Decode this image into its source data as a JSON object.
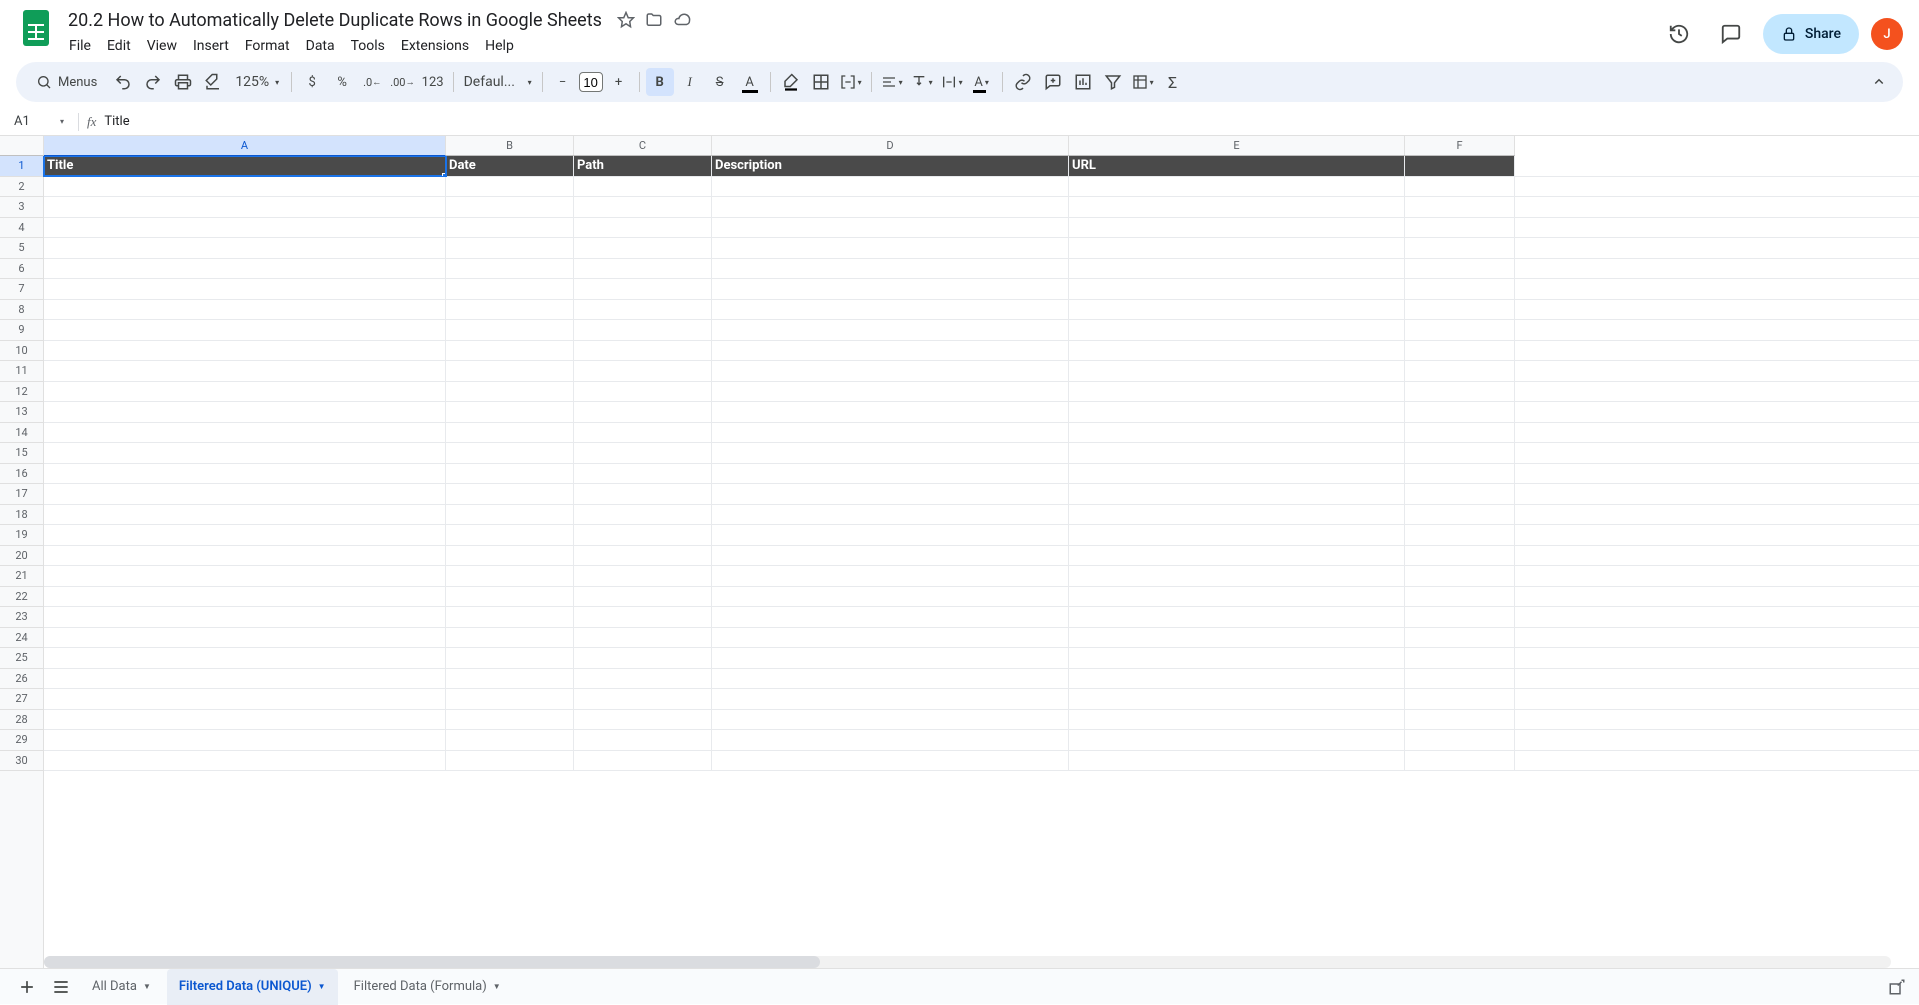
{
  "header": {
    "doc_title": "20.2 How to Automatically Delete Duplicate Rows in Google Sheets",
    "share_label": "Share",
    "avatar_initial": "J"
  },
  "menubar": [
    "File",
    "Edit",
    "View",
    "Insert",
    "Format",
    "Data",
    "Tools",
    "Extensions",
    "Help"
  ],
  "toolbar": {
    "menus_label": "Menus",
    "zoom": "125%",
    "currency": "$",
    "percent": "%",
    "dec_decrease": ".0←",
    "dec_increase": ".00→",
    "numfmt": "123",
    "font": "Defaul...",
    "font_size": "10",
    "bold": "B",
    "italic": "I",
    "strike": "S",
    "text_color": "A",
    "functions": "Σ"
  },
  "namebox": {
    "ref": "A1",
    "formula": "Title"
  },
  "columns": [
    "A",
    "B",
    "C",
    "D",
    "E",
    "F"
  ],
  "row_count": 30,
  "header_row": [
    "Title",
    "Date",
    "Path",
    "Description",
    "URL"
  ],
  "sheet_tabs": {
    "all_data": "All Data",
    "filtered_unique": "Filtered Data (UNIQUE)",
    "filtered_formula": "Filtered Data (Formula)"
  }
}
